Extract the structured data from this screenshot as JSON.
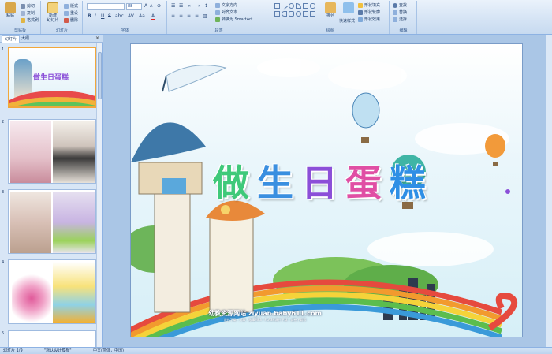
{
  "ribbon": {
    "clipboard": {
      "paste": "粘贴",
      "cut": "剪切",
      "copy": "复制",
      "format_painter": "格式刷",
      "label": "剪贴板"
    },
    "slides": {
      "new_slide": "新建\n幻灯片",
      "layout": "版式",
      "reset": "重设",
      "delete": "删除",
      "label": "幻灯片"
    },
    "font": {
      "font_name": "",
      "font_size": "88",
      "label": "字体"
    },
    "paragraph": {
      "text_direction": "文字方向",
      "align_text": "对齐文本",
      "smartart": "转换为 SmartArt",
      "label": "段落"
    },
    "drawing": {
      "arrange": "排列",
      "quick_styles": "快速样式",
      "shape_fill": "形状填充",
      "shape_outline": "形状轮廓",
      "shape_effects": "形状效果",
      "label": "绘图"
    },
    "editing": {
      "find": "查找",
      "replace": "替换",
      "select": "选择",
      "label": "编辑"
    }
  },
  "panel": {
    "tabs": [
      "幻灯片",
      "大纲"
    ],
    "close": "×",
    "slide_numbers": [
      "1",
      "2",
      "3",
      "4",
      "5"
    ]
  },
  "slide": {
    "title_chars": [
      "做",
      "生",
      "日",
      "蛋",
      "糕"
    ],
    "site": "幼教资源网站 ziyuan.baby611.com",
    "site_sub": "课件下载 · 儿歌 · 故事MP3 · FLASH课件下载 · 试卷下载等"
  },
  "status": {
    "slide_index": "幻灯片 1/9",
    "theme": "\"默认设计模板\"",
    "language": "中文(简体，中国)"
  },
  "colors": {
    "title": [
      "#3fc97a",
      "#3a8fe0",
      "#8b4fd8",
      "#e04fa4",
      "#2f8fe5"
    ],
    "selected_border": "#f2a73b"
  }
}
